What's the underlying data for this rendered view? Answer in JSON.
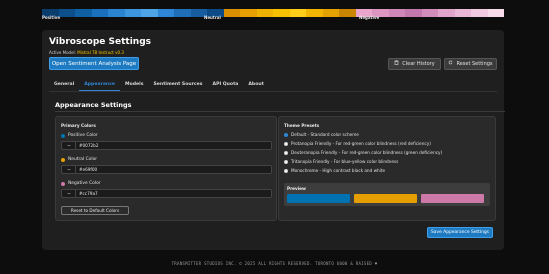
{
  "spectrum": {
    "labels": {
      "positive": "Positive",
      "neutral": "Neutral",
      "negative": "Negative"
    },
    "colors": [
      "#0a3d6e",
      "#0d4f8a",
      "#0f5fa3",
      "#1a70bd",
      "#2b84d1",
      "#3d95dd",
      "#4ea3e4",
      "#2f86d6",
      "#1e6fb8",
      "#165c9e",
      "#0c4a86",
      "#d98e00",
      "#e6a100",
      "#efb200",
      "#f5c000",
      "#ffcc1a",
      "#f1b400",
      "#e4a200",
      "#c98400",
      "#e9a5cb",
      "#dd96c2",
      "#cf86b8",
      "#c378ad",
      "#d18cbc",
      "#e1a4cb",
      "#eab7d6",
      "#f2c9e0",
      "#f7dbea"
    ]
  },
  "header": {
    "title": "Vibroscope Settings",
    "model_prefix": "Active Model:",
    "model_value": "Mistral 7B Instruct v0.3",
    "open_page_button": "Open Sentiment Analysis Page",
    "clear_history_button": "Clear History",
    "reset_settings_button": "Reset Settings"
  },
  "tabs": [
    {
      "label": "General"
    },
    {
      "label": "Appearance"
    },
    {
      "label": "Models"
    },
    {
      "label": "Sentiment Sources"
    },
    {
      "label": "API Quota"
    },
    {
      "label": "About"
    }
  ],
  "appearance": {
    "section_title": "Appearance Settings",
    "primary_colors": {
      "title": "Primary Colors",
      "positive": {
        "label": "Positive Color",
        "value": "#0072b2",
        "color": "#0072b2"
      },
      "neutral": {
        "label": "Neutral Color",
        "value": "#e69f00",
        "color": "#e69f00"
      },
      "negative": {
        "label": "Negative Color",
        "value": "#cc79a7",
        "color": "#cc79a7"
      },
      "reset_button": "Reset to Default Colors"
    },
    "theme_presets": {
      "title": "Theme Presets",
      "options": [
        {
          "label": "Default - Standard color scheme",
          "selected": true
        },
        {
          "label": "Protanopia Friendly - For red-green color blindness (red deficiency)",
          "selected": false
        },
        {
          "label": "Deuteranopia Friendly - For red-green color blindness (green deficiency)",
          "selected": false
        },
        {
          "label": "Tritanopia Friendly - For blue-yellow color blindness",
          "selected": false
        },
        {
          "label": "Monochrome - High contrast black and white",
          "selected": false
        }
      ],
      "preview_title": "Preview"
    },
    "save_button": "Save Appearance Settings"
  },
  "footer": "TRANSMITTER STUDIOS INC. © 2025 ALL RIGHTS RESERVED. TORONTO 6000 & RAISED ♥"
}
